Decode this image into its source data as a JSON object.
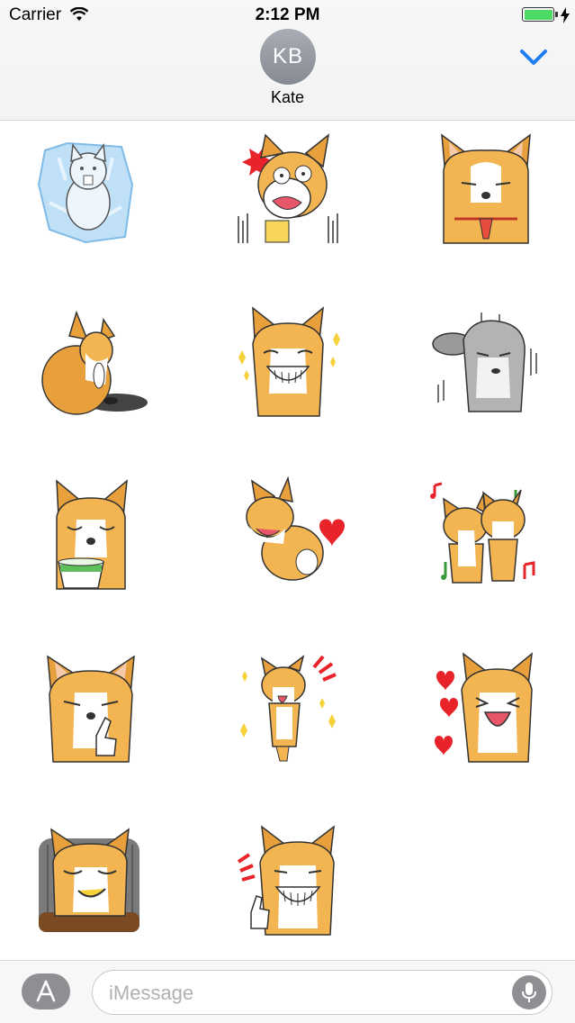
{
  "status_bar": {
    "carrier": "Carrier",
    "time": "2:12 PM",
    "battery_color": "#4cd964"
  },
  "header": {
    "avatar_initials": "KB",
    "contact_name": "Kate",
    "accent": "#1e7cf2"
  },
  "stickers": [
    {
      "name": "frozen-corgi-sticker"
    },
    {
      "name": "shocked-corgi-sticker"
    },
    {
      "name": "tie-corgi-sticker"
    },
    {
      "name": "sitting-corgi-sticker"
    },
    {
      "name": "grinning-sparkle-corgi-sticker"
    },
    {
      "name": "gloomy-gray-corgi-sticker"
    },
    {
      "name": "tea-cup-corgi-sticker"
    },
    {
      "name": "heart-butt-corgi-sticker"
    },
    {
      "name": "dancing-corgis-sticker"
    },
    {
      "name": "pointing-corgi-sticker"
    },
    {
      "name": "tongue-out-corgi-sticker"
    },
    {
      "name": "hearts-laughing-corgi-sticker"
    },
    {
      "name": "smirking-corgi-sticker"
    },
    {
      "name": "thumbs-up-corgi-sticker"
    }
  ],
  "composer": {
    "placeholder": "iMessage",
    "app_store_icon": "app-store-icon",
    "mic_icon": "microphone-icon"
  }
}
